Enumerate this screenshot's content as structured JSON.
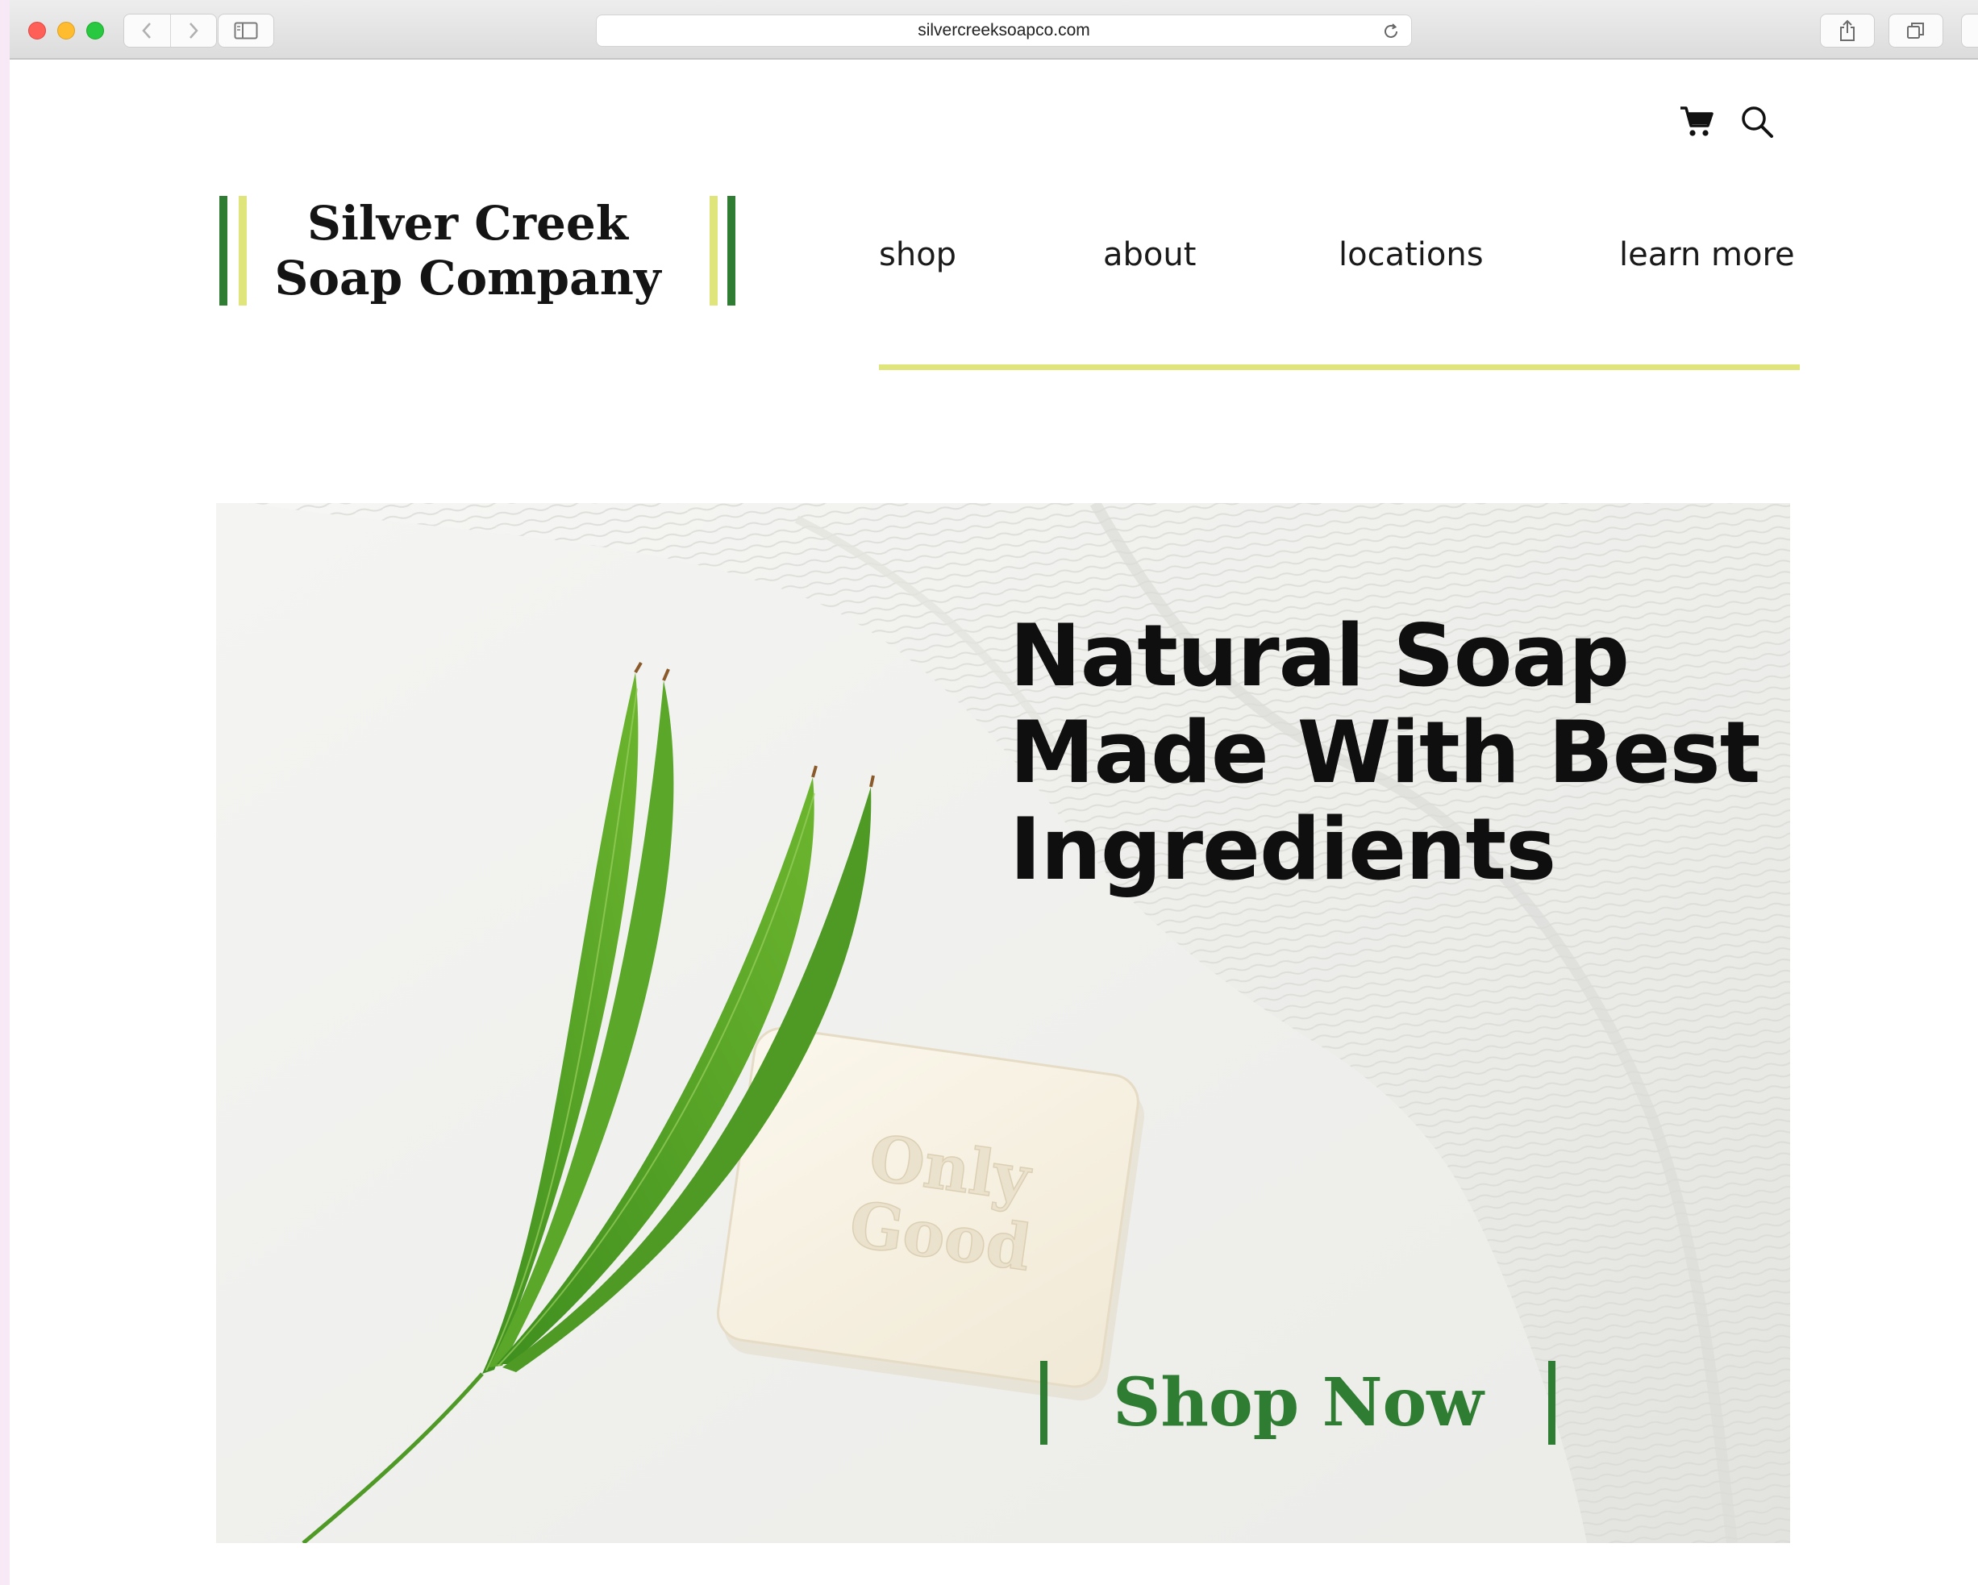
{
  "browser": {
    "url": "silvercreeksoapco.com",
    "icons": [
      "back-icon",
      "forward-icon",
      "sidebar-icon",
      "reload-icon",
      "share-icon",
      "tabs-icon"
    ]
  },
  "header": {
    "logo_line1": "Silver Creek",
    "logo_line2": "Soap Company",
    "icons": [
      "cart-icon",
      "search-icon"
    ],
    "nav": [
      {
        "label": "shop"
      },
      {
        "label": "about"
      },
      {
        "label": "locations"
      },
      {
        "label": "learn more"
      }
    ]
  },
  "hero": {
    "title_lines": [
      "Natural Soap",
      "Made With Best",
      "Ingredients"
    ],
    "cta_label": "Shop Now",
    "soap_imprint_line1": "Only",
    "soap_imprint_line2": "Good"
  },
  "colors": {
    "brand_green": "#2f7d32",
    "accent_lime": "#dfe57a",
    "text_dark": "#141414"
  }
}
